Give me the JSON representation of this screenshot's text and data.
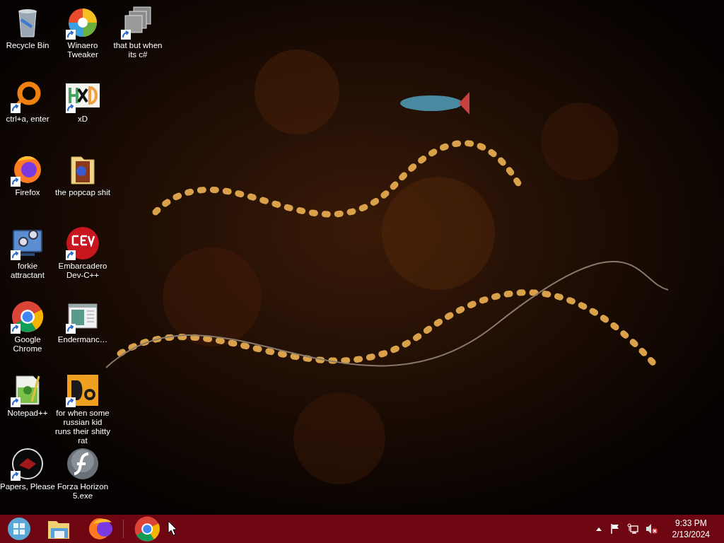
{
  "desktop_icons": [
    {
      "label": "Recycle Bin",
      "kind": "recycle",
      "shortcut": false
    },
    {
      "label": "ctrl+a, enter",
      "kind": "ring",
      "shortcut": true
    },
    {
      "label": "Firefox",
      "kind": "firefox",
      "shortcut": true
    },
    {
      "label": "forkie attractant",
      "kind": "gears",
      "shortcut": true
    },
    {
      "label": "Google Chrome",
      "kind": "chrome",
      "shortcut": true
    },
    {
      "label": "Notepad++",
      "kind": "notepad",
      "shortcut": true
    },
    {
      "label": "Papers, Please",
      "kind": "papers",
      "shortcut": true
    },
    {
      "label": "Winaero Tweaker",
      "kind": "swirl",
      "shortcut": true
    },
    {
      "label": "xD",
      "kind": "hxd",
      "shortcut": true
    },
    {
      "label": "the popcap shit",
      "kind": "folder",
      "shortcut": false
    },
    {
      "label": "Embarcadero Dev-C++",
      "kind": "devcpp",
      "shortcut": true
    },
    {
      "label": "Endermanc…",
      "kind": "window",
      "shortcut": true
    },
    {
      "label": "for when some russian kid runs their shitty rat",
      "kind": "de",
      "shortcut": true
    },
    {
      "label": "Forza Horizon 5.exe",
      "kind": "flash",
      "shortcut": false
    },
    {
      "label": "that but when its c#",
      "kind": "stack",
      "shortcut": true
    }
  ],
  "taskbar": {
    "apps": [
      {
        "kind": "explorer"
      },
      {
        "kind": "firefox"
      },
      {
        "kind": "separator"
      },
      {
        "kind": "chrome"
      }
    ],
    "tray": {
      "time": "9:33 PM",
      "date": "2/13/2024"
    }
  }
}
